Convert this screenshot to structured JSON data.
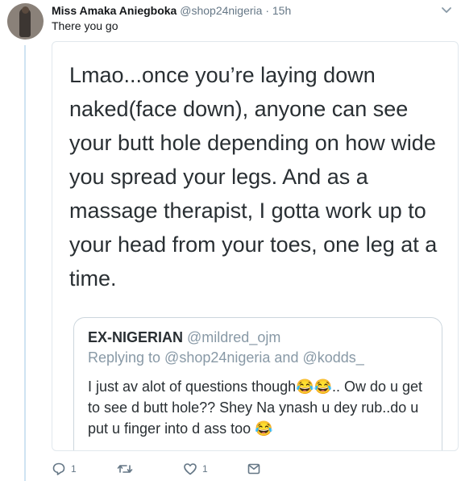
{
  "tweet": {
    "author_name": "Miss Amaka Aniegboka",
    "author_handle": "@shop24nigeria",
    "separator": "·",
    "time": "15h",
    "text": "There you go",
    "avatar_icon": "profile-photo",
    "menu_icon": "chevron-down-icon"
  },
  "screenshot_card": {
    "text": "Lmao...once you’re laying down naked(face down), anyone can see your butt hole depending on how wide you spread your legs. And as a massage therapist, I gotta work up to your head from your toes, one leg at a time.",
    "quoted_tweet": {
      "name": "EX-NIGERIAN",
      "handle": "@mildred_ojm",
      "replying_to": "Replying to @shop24nigeria and @kodds_",
      "text_part1": "I just av alot of questions though",
      "emoji_1": "😂😂",
      "text_part2": ".. Ow do u get to see d butt hole?? Shey Na ynash u dey rub..do u put u finger into d ass too ",
      "emoji_2": "😂"
    }
  },
  "actions": {
    "reply_count": "1",
    "retweet_count": "",
    "like_count": "1",
    "icons": [
      "reply-icon",
      "retweet-icon",
      "like-icon",
      "message-icon"
    ]
  },
  "colors": {
    "text_primary": "#14171a",
    "text_secondary": "#657786",
    "thread_line": "#cfe3f2",
    "border": "#e1e8ed"
  }
}
